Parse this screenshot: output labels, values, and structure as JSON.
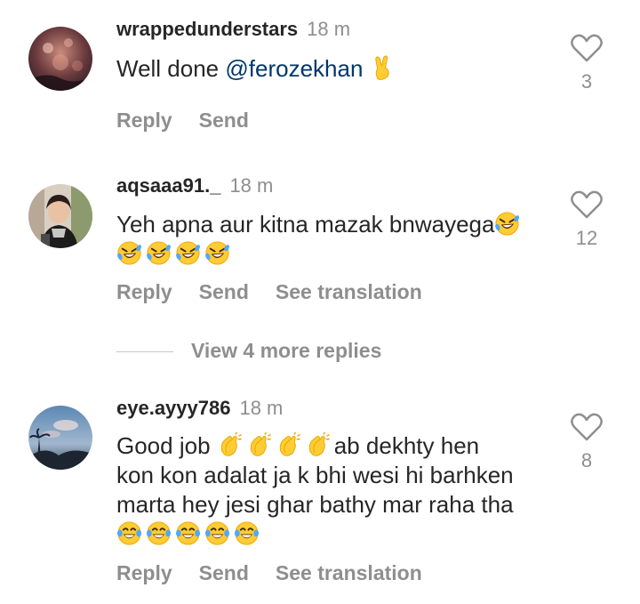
{
  "comments": [
    {
      "username": "wrappedunderstars",
      "time": "18 m",
      "text_prefix": "Well done ",
      "mention": "@ferozekhan",
      "emoji": [
        "victory-hand"
      ],
      "likes": "3",
      "actions": {
        "reply": "Reply",
        "send": "Send"
      }
    },
    {
      "username": "aqsaaa91._",
      "time": "18 m",
      "text": "Yeh apna aur kitna mazak bnwayega",
      "emoji": [
        "rolling-laughing",
        "rolling-laughing",
        "rolling-laughing",
        "rolling-laughing",
        "rolling-laughing"
      ],
      "likes": "12",
      "actions": {
        "reply": "Reply",
        "send": "Send",
        "translate": "See translation"
      }
    },
    {
      "username": "eye.ayyy786",
      "time": "18 m",
      "text_prefix": "Good job",
      "text_suffix": "ab dekhty hen",
      "text_line2": "kon kon adalat ja k bhi wesi hi barhken",
      "text_line3": "marta hey jesi ghar bathy mar raha tha",
      "emoji_clap": [
        "clapping-hands",
        "clapping-hands",
        "clapping-hands",
        "clapping-hands"
      ],
      "emoji_laugh": [
        "tears-of-joy",
        "tears-of-joy",
        "tears-of-joy",
        "tears-of-joy",
        "tears-of-joy"
      ],
      "likes": "8",
      "actions": {
        "reply": "Reply",
        "send": "Send",
        "translate": "See translation"
      }
    }
  ],
  "view_more_replies": "View 4 more replies",
  "colors": {
    "text": "#262626",
    "muted": "#8e8e8e",
    "mention": "#00376b",
    "emoji_yellow": "#ffcc33"
  }
}
